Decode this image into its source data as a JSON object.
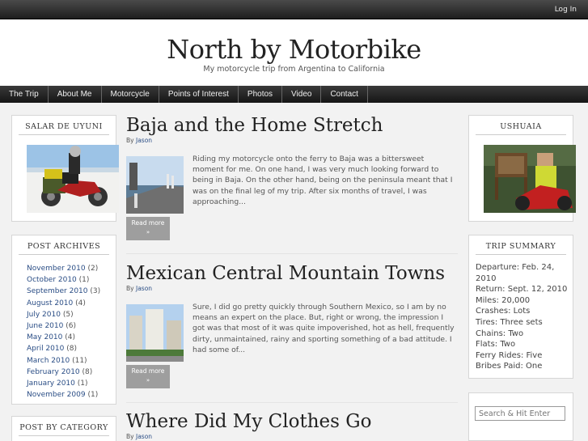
{
  "topbar": {
    "login": "Log In"
  },
  "site": {
    "title": "North by Motorbike",
    "tagline": "My motorcycle trip from Argentina to California"
  },
  "nav": [
    "The Trip",
    "About Me",
    "Motorcycle",
    "Points of Interest",
    "Photos",
    "Video",
    "Contact"
  ],
  "sidebar_left": {
    "photo_widget_title": "SALAR DE UYUNI",
    "archives_title": "POST ARCHIVES",
    "archives": [
      {
        "month": "November 2010",
        "count": "(2)"
      },
      {
        "month": "October 2010",
        "count": "(1)"
      },
      {
        "month": "September 2010",
        "count": "(3)"
      },
      {
        "month": "August 2010",
        "count": "(4)"
      },
      {
        "month": "July 2010",
        "count": "(5)"
      },
      {
        "month": "June 2010",
        "count": "(6)"
      },
      {
        "month": "May 2010",
        "count": "(4)"
      },
      {
        "month": "April 2010",
        "count": "(8)"
      },
      {
        "month": "March 2010",
        "count": "(11)"
      },
      {
        "month": "February 2010",
        "count": "(8)"
      },
      {
        "month": "January 2010",
        "count": "(1)"
      },
      {
        "month": "November 2009",
        "count": "(1)"
      }
    ],
    "category_title": "POST BY CATEGORY"
  },
  "sidebar_right": {
    "photo_widget_title": "USHUAIA",
    "summary_title": "TRIP SUMMARY",
    "summary": [
      "Departure: Feb. 24, 2010",
      "Return: Sept. 12, 2010",
      "Miles: 20,000",
      "Crashes: Lots",
      "Tires: Three sets",
      "Chains: Two",
      "Flats: Two",
      "Ferry Rides: Five",
      "Bribes Paid: One"
    ],
    "search_placeholder": "Search & Hit Enter"
  },
  "posts": [
    {
      "title": "Baja and the Home Stretch",
      "by": "By",
      "author": "Jason",
      "excerpt": "Riding my motorcycle onto the ferry to Baja was a bittersweet moment for me.  On one hand, I was very much looking forward to being in Baja.  On the other hand, being on the peninsula meant that I was on the final leg of my trip.  After six months of travel, I was approaching...",
      "read_more": "Read more",
      "arrow": "»"
    },
    {
      "title": "Mexican Central Mountain Towns",
      "by": "By",
      "author": "Jason",
      "excerpt": "Sure, I did go pretty quickly through Southern Mexico, so I am by no means an expert on the place.  But, right or wrong, the impression I got was that most of it was quite impoverished, hot as hell, frequently dirty, unmaintained, rainy and sporting something of a bad attitude.  I had some of...",
      "read_more": "Read more",
      "arrow": "»"
    },
    {
      "title": "Where Did My Clothes Go",
      "by": "By",
      "author": "Jason"
    }
  ]
}
